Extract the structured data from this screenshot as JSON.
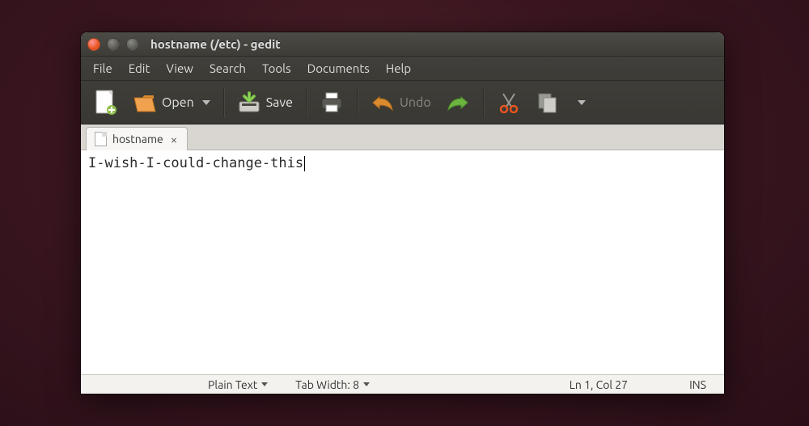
{
  "window": {
    "title": "hostname (/etc) - gedit"
  },
  "menubar": {
    "items": [
      "File",
      "Edit",
      "View",
      "Search",
      "Tools",
      "Documents",
      "Help"
    ]
  },
  "toolbar": {
    "new_icon": "new-document-icon",
    "open_label": "Open",
    "save_label": "Save",
    "undo_label": "Undo"
  },
  "tabs": [
    {
      "label": "hostname"
    }
  ],
  "editor": {
    "content": "I-wish-I-could-change-this"
  },
  "statusbar": {
    "language": "Plain Text",
    "tabwidth": "Tab Width: 8",
    "position": "Ln 1, Col 27",
    "mode": "INS"
  }
}
